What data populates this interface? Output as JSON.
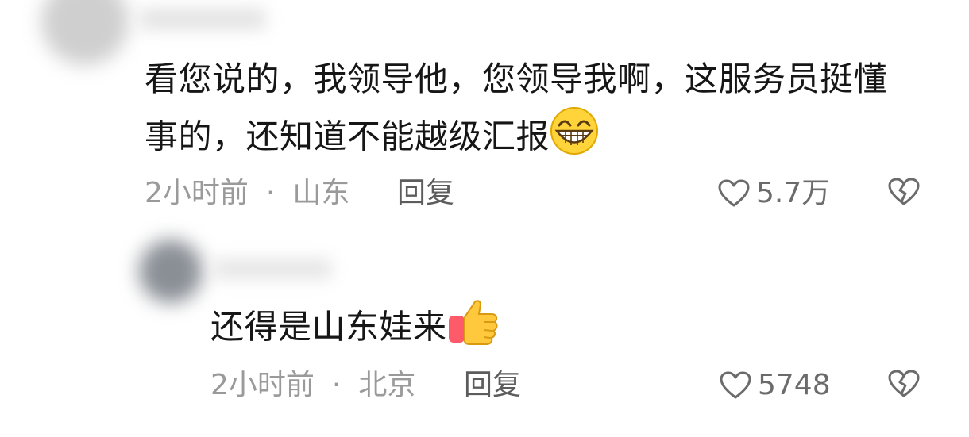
{
  "comments": [
    {
      "text_line1": "看您说的，我领导他，您领导我啊，这服务员挺懂",
      "text_line2": "事的，还知道不能越级汇报",
      "emoji": "grinning-face-emoji",
      "time": "2小时前",
      "separator": "·",
      "location": "山东",
      "reply_label": "回复",
      "likes": "5.7万"
    },
    {
      "text_line1": "还得是山东娃来",
      "emoji": "thumbs-up-emoji",
      "time": "2小时前",
      "separator": "·",
      "location": "北京",
      "reply_label": "回复",
      "likes": "5748"
    }
  ],
  "icons": {
    "like": "heart-outline-icon",
    "dislike": "broken-heart-icon"
  },
  "colors": {
    "text": "#161616",
    "meta": "#9a9a9a",
    "reply": "#5c5c5c",
    "icon": "#6b6b6b"
  }
}
